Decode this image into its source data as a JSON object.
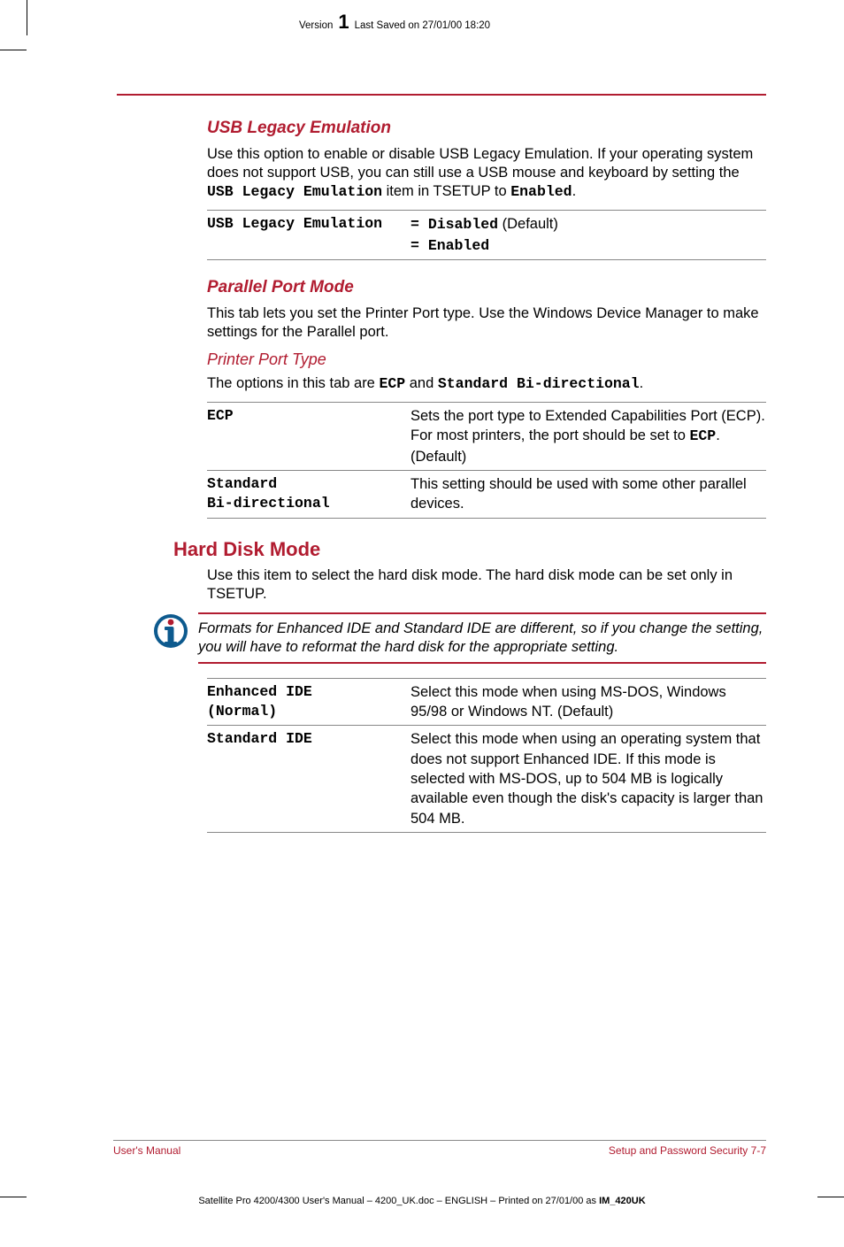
{
  "header": {
    "version_label": "Version",
    "version_number": "1",
    "last_saved": "Last Saved on 27/01/00 18:20"
  },
  "sections": {
    "usb_legacy": {
      "heading": "USB Legacy Emulation",
      "para_pre": "Use this option to enable or disable USB Legacy Emulation. If your operating system does not support USB, you can still use a USB mouse and keyboard by setting the ",
      "para_mono": "USB Legacy Emulation",
      "para_mid": " item in TSETUP to ",
      "para_mono2": "Enabled",
      "para_end": ".",
      "opt_label": "USB Legacy Emulation",
      "opt_line1_pre": "= ",
      "opt_line1_mono": "Disabled",
      "opt_line1_suffix": " (Default)",
      "opt_line2_pre": "= ",
      "opt_line2_mono": "Enabled"
    },
    "parallel": {
      "heading": "Parallel Port Mode",
      "para": "This tab lets you set the Printer Port type. Use the Windows Device Manager to make settings for the Parallel port.",
      "sub_heading": "Printer Port Type",
      "sub_para_pre": "The options in this tab are ",
      "sub_para_m1": "ECP",
      "sub_para_mid": " and ",
      "sub_para_m2": "Standard Bi-directional",
      "sub_para_end": ".",
      "row1_label": "ECP",
      "row1_desc_pre": "Sets the port type to Extended Capabilities Port (ECP). For most printers, the port should be set to ",
      "row1_desc_mono": "ECP",
      "row1_desc_end": ". (Default)",
      "row2_label_l1": "Standard",
      "row2_label_l2": "Bi-directional",
      "row2_desc": "This setting should be used with some other parallel devices."
    },
    "hdd": {
      "heading": "Hard Disk Mode",
      "para": "Use this item to select the hard disk mode. The hard disk mode can be set only in TSETUP.",
      "info": "Formats for Enhanced IDE and Standard IDE are different, so if you change the setting, you will have to reformat the hard disk for the appropriate setting.",
      "row1_label_l1": "Enhanced IDE",
      "row1_label_l2": "(Normal)",
      "row1_desc": "Select this mode when using MS-DOS, Windows 95/98 or Windows NT. (Default)",
      "row2_label": "Standard IDE",
      "row2_desc": "Select this mode when using an operating system that does not support Enhanced IDE. If this mode is selected with MS-DOS, up to 504 MB is logically available even though the disk's capacity is larger than 504 MB."
    }
  },
  "footer": {
    "left": "User's Manual",
    "right": "Setup and Password Security  7-7",
    "printline_pre": "Satellite Pro 4200/4300 User's Manual  – 4200_UK.doc – ENGLISH – Printed on 27/01/00 as ",
    "printline_bold": "IM_420UK"
  }
}
